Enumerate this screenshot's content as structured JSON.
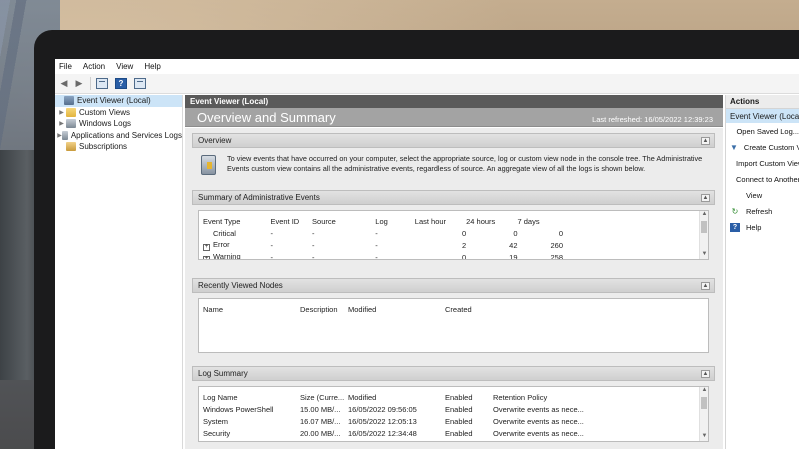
{
  "menu": [
    "File",
    "Action",
    "View",
    "Help"
  ],
  "toolbar": {
    "back_glyph": "◀",
    "forward_glyph": "▶",
    "help_glyph": "?"
  },
  "tree": {
    "root": "Event Viewer (Local)",
    "items": [
      {
        "label": "Custom Views",
        "icon": "folder-icon"
      },
      {
        "label": "Windows Logs",
        "icon": "log-icon"
      },
      {
        "label": "Applications and Services Logs",
        "icon": "log-icon"
      },
      {
        "label": "Subscriptions",
        "icon": "subscriptions-icon"
      }
    ]
  },
  "center": {
    "title": "Event Viewer (Local)",
    "banner_title": "Overview and Summary",
    "last_refreshed": "Last refreshed: 16/05/2022 12:39:23",
    "overview": {
      "heading": "Overview",
      "text": "To view events that have occurred on your computer, select the appropriate source, log or custom view node in the console tree. The Administrative Events custom view contains all the administrative events, regardless of source. An aggregate view of all the logs is shown below."
    },
    "summary": {
      "heading": "Summary of Administrative Events",
      "columns": [
        "Event Type",
        "Event ID",
        "Source",
        "Log",
        "Last hour",
        "24 hours",
        "7 days"
      ],
      "rows": [
        {
          "type": "Critical",
          "expandable": false,
          "id": "-",
          "source": "-",
          "log": "-",
          "hour": "0",
          "day": "0",
          "week": "0"
        },
        {
          "type": "Error",
          "expandable": true,
          "id": "-",
          "source": "-",
          "log": "-",
          "hour": "2",
          "day": "42",
          "week": "260"
        },
        {
          "type": "Warning",
          "expandable": true,
          "id": "-",
          "source": "-",
          "log": "-",
          "hour": "0",
          "day": "19",
          "week": "258"
        }
      ]
    },
    "recent": {
      "heading": "Recently Viewed Nodes",
      "columns": [
        "Name",
        "Description",
        "Modified",
        "Created"
      ]
    },
    "logsummary": {
      "heading": "Log Summary",
      "columns": [
        "Log Name",
        "Size (Curre...",
        "Modified",
        "Enabled",
        "Retention Policy"
      ],
      "rows": [
        {
          "name": "Windows PowerShell",
          "size": "15.00 MB/...",
          "modified": "16/05/2022 09:56:05",
          "enabled": "Enabled",
          "policy": "Overwrite events as nece..."
        },
        {
          "name": "System",
          "size": "16.07 MB/...",
          "modified": "16/05/2022 12:05:13",
          "enabled": "Enabled",
          "policy": "Overwrite events as nece..."
        },
        {
          "name": "Security",
          "size": "20.00 MB/...",
          "modified": "16/05/2022 12:34:48",
          "enabled": "Enabled",
          "policy": "Overwrite events as nece..."
        }
      ]
    }
  },
  "actions": {
    "head": "Actions",
    "sub": "Event Viewer (Local)",
    "items": [
      {
        "label": "Open Saved Log...",
        "icon": "folder-icon"
      },
      {
        "label": "Create Custom View...",
        "icon": "funnel-icon"
      },
      {
        "label": "Import Custom View...",
        "icon": ""
      },
      {
        "label": "Connect to Another Computer...",
        "icon": ""
      },
      {
        "label": "View",
        "icon": ""
      },
      {
        "label": "Refresh",
        "icon": "refresh-icon"
      },
      {
        "label": "Help",
        "icon": "help-icon"
      }
    ]
  }
}
